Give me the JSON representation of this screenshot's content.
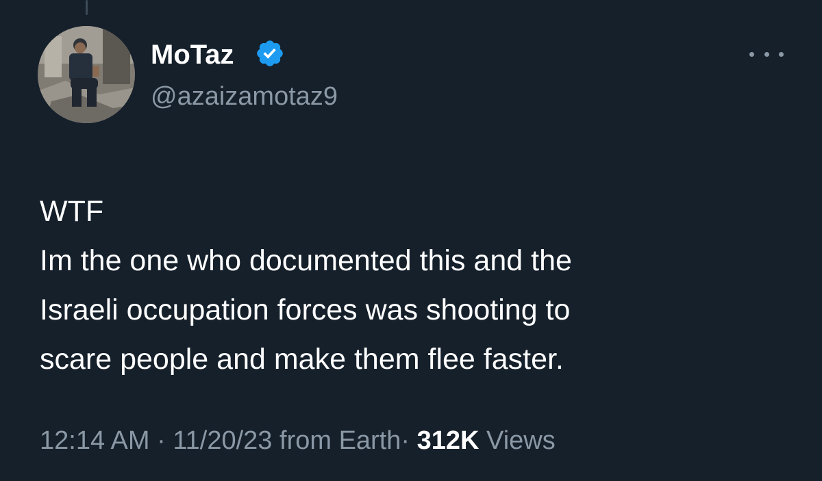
{
  "tweet": {
    "author": {
      "name": "MoTaz",
      "handle": "@azaizamotaz9",
      "verified": true,
      "avatar_icon": "profile-photo"
    },
    "text_lines": [
      "WTF",
      "Im the one who documented this and the",
      "Israeli occupation forces was shooting to",
      "scare people and make them flee faster."
    ],
    "meta": {
      "time": "12:14 AM",
      "separator": "·",
      "date": "11/20/23",
      "source": "from Earth",
      "views_count": "312K",
      "views_label": "Views"
    },
    "more_icon": "more-horizontal-icon"
  },
  "colors": {
    "background": "#15202b",
    "primary_text": "#ffffff",
    "secondary_text": "#8b98a5",
    "verified_blue": "#1d9bf0"
  }
}
